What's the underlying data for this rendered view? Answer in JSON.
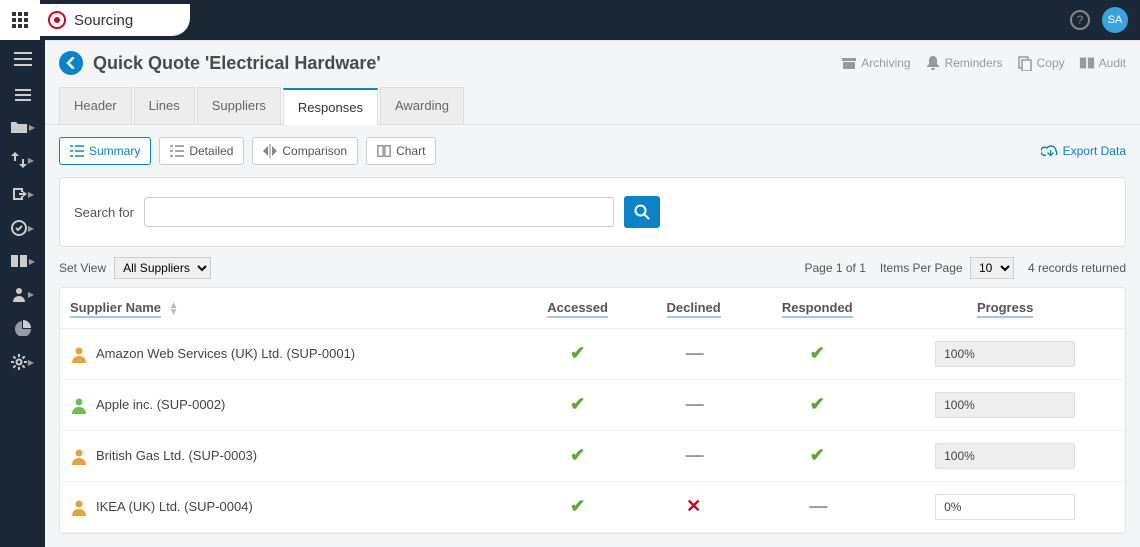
{
  "brand": "Sourcing",
  "userInitials": "SA",
  "pageTitle": "Quick Quote 'Electrical Hardware'",
  "titleActions": {
    "archiving": "Archiving",
    "reminders": "Reminders",
    "copy": "Copy",
    "audit": "Audit"
  },
  "tabs": {
    "header": "Header",
    "lines": "Lines",
    "suppliers": "Suppliers",
    "responses": "Responses",
    "awarding": "Awarding"
  },
  "views": {
    "summary": "Summary",
    "detailed": "Detailed",
    "comparison": "Comparison",
    "chart": "Chart"
  },
  "exportLabel": "Export Data",
  "search": {
    "label": "Search for",
    "value": ""
  },
  "filter": {
    "setViewLabel": "Set View",
    "setViewValue": "All Suppliers",
    "pageInfo": "Page 1 of 1",
    "itemsPerPageLabel": "Items Per Page",
    "itemsPerPageValue": "10",
    "recordsReturned": "4 records returned"
  },
  "columns": {
    "supplier": "Supplier Name",
    "accessed": "Accessed",
    "declined": "Declined",
    "responded": "Responded",
    "progress": "Progress"
  },
  "rows": [
    {
      "name": "Amazon Web Services (UK) Ltd. (SUP-0001)",
      "iconColor": "#e6a23c",
      "accessed": "check",
      "declined": "dash",
      "responded": "check",
      "progress": "100%",
      "progressFilled": true
    },
    {
      "name": "Apple inc. (SUP-0002)",
      "iconColor": "#6fbf4b",
      "accessed": "check",
      "declined": "dash",
      "responded": "check",
      "progress": "100%",
      "progressFilled": true
    },
    {
      "name": "British Gas Ltd. (SUP-0003)",
      "iconColor": "#e6a23c",
      "accessed": "check",
      "declined": "dash",
      "responded": "check",
      "progress": "100%",
      "progressFilled": true
    },
    {
      "name": "IKEA (UK) Ltd. (SUP-0004)",
      "iconColor": "#e6a23c",
      "accessed": "check",
      "declined": "cross",
      "responded": "dash",
      "progress": "0%",
      "progressFilled": false
    }
  ]
}
